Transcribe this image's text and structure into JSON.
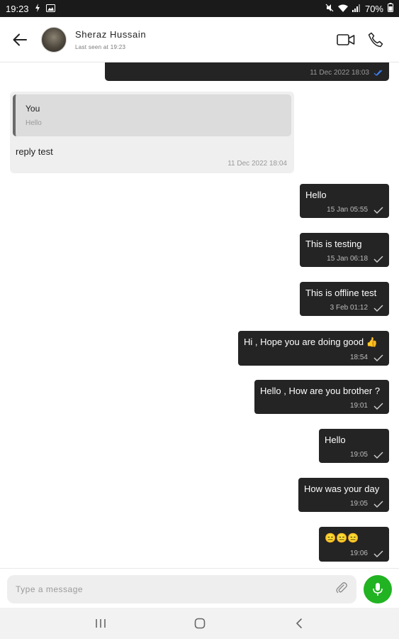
{
  "status_bar": {
    "time": "19:23",
    "battery": "70%"
  },
  "header": {
    "contact_name": "Sheraz Hussain",
    "last_seen": "Last seen at 19:23"
  },
  "chat": {
    "partial_message": {
      "time": "11 Dec 2022 18:03"
    },
    "incoming_reply": {
      "quoted_author": "You",
      "quoted_text": "Hello",
      "text": "reply test",
      "time": "11 Dec 2022 18:04"
    },
    "outgoing": [
      {
        "text": "Hello",
        "time": "15 Jan 05:55"
      },
      {
        "text": "This is testing",
        "time": "15 Jan 06:18"
      },
      {
        "text": "This is offline test",
        "time": "3 Feb 01:12"
      },
      {
        "text": "Hi , Hope you are doing good 👍",
        "time": "18:54"
      },
      {
        "text": "Hello , How are you brother ?",
        "time": "19:01"
      },
      {
        "text": "Hello",
        "time": "19:05"
      },
      {
        "text": "How was your day",
        "time": "19:05"
      },
      {
        "text": "😑😑😑",
        "time": "19:06"
      }
    ]
  },
  "composer": {
    "placeholder": "Type a message"
  },
  "colors": {
    "outgoing_bubble": "#242424",
    "incoming_bubble": "#efefef",
    "mic_button": "#21b321",
    "read_tick": "#3b82f6"
  }
}
